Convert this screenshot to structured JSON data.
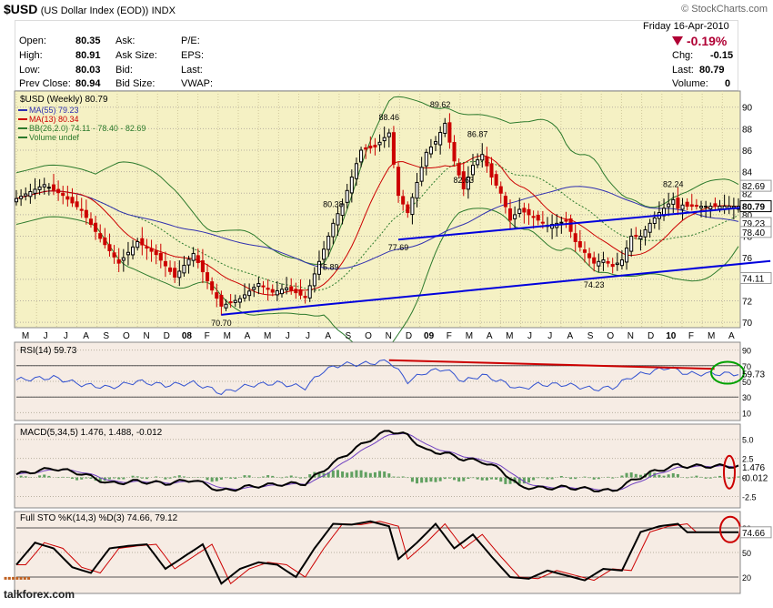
{
  "header": {
    "symbol": "$USD",
    "name": "(US Dollar Index (EOD))",
    "exchange": "INDX",
    "brand": "© StockCharts.com"
  },
  "quote": {
    "date": "Friday  16-Apr-2010",
    "change_pct": "-0.19%",
    "open_label": "Open:",
    "open": "80.35",
    "high_label": "High:",
    "high": "80.91",
    "low_label": "Low:",
    "low": "80.03",
    "prev_label": "Prev Close:",
    "prev": "80.94",
    "ask_label": "Ask:",
    "ask_size_label": "Ask Size:",
    "bid_label": "Bid:",
    "bid_size_label": "Bid Size:",
    "pe_label": "P/E:",
    "eps_label": "EPS:",
    "last_label_mid": "Last:",
    "vwap_label": "VWAP:",
    "chg_label": "Chg:",
    "chg": "-0.15",
    "last_label": "Last:",
    "last": "80.79",
    "volume_label": "Volume:",
    "volume": "0"
  },
  "colors": {
    "price_bg": "#f5f1c4",
    "ind_bg": "#f6ece4",
    "up": "#000000",
    "down": "#cc0000",
    "ma55": "#3030b0",
    "ma13": "#cc0000",
    "bb": "#2c7a2c",
    "trend": "#0000dd",
    "rsi": "#3050d0",
    "macd": "#000000",
    "signal": "#7040c0",
    "hist": "#60a060",
    "sto_k": "#000000",
    "sto_d": "#cc0000",
    "annot": "#00a000"
  },
  "chart_data": [
    {
      "type": "candlestick",
      "title": "$USD (Weekly) 80.79",
      "legend": [
        {
          "label": "MA(55) 79.23",
          "color": "#3030b0"
        },
        {
          "label": "MA(13) 80.34",
          "color": "#cc0000"
        },
        {
          "label": "BB(26,2.0) 74.11 - 78.40 - 82.69",
          "color": "#2c7a2c"
        },
        {
          "label": "Volume undef",
          "color": "#2c7a2c"
        }
      ],
      "x_ticks": [
        "M",
        "J",
        "J",
        "A",
        "S",
        "O",
        "N",
        "D",
        "08",
        "F",
        "M",
        "A",
        "M",
        "J",
        "J",
        "A",
        "S",
        "O",
        "N",
        "D",
        "09",
        "F",
        "M",
        "A",
        "M",
        "J",
        "J",
        "A",
        "S",
        "O",
        "N",
        "D",
        "10",
        "F",
        "M",
        "A"
      ],
      "ylim": [
        69.5,
        91.5
      ],
      "y_ticks": [
        70,
        72,
        74,
        76,
        78,
        80,
        82,
        84,
        86,
        88,
        90
      ],
      "annotations": [
        {
          "label": "70.70",
          "week": 44,
          "value": 70.7
        },
        {
          "label": "75.89",
          "week": 67,
          "value": 75.89
        },
        {
          "label": "80.38",
          "week": 68,
          "value": 80.38
        },
        {
          "label": "88.46",
          "week": 80,
          "value": 88.46
        },
        {
          "label": "77.69",
          "week": 82,
          "value": 77.69
        },
        {
          "label": "89.62",
          "week": 91,
          "value": 89.62
        },
        {
          "label": "82.63",
          "week": 96,
          "value": 82.63
        },
        {
          "label": "86.87",
          "week": 99,
          "value": 86.87
        },
        {
          "label": "74.23",
          "week": 124,
          "value": 74.23
        },
        {
          "label": "82.24",
          "week": 141,
          "value": 82.24
        }
      ],
      "right_labels": [
        {
          "label": "82.69",
          "value": 82.69
        },
        {
          "label": "80.79",
          "value": 80.79
        },
        {
          "label": "79.23",
          "value": 79.23
        },
        {
          "label": "78.40",
          "value": 78.4
        },
        {
          "label": "74.11",
          "value": 74.11
        }
      ],
      "anchors": [
        [
          0,
          81.5
        ],
        [
          6,
          82.8
        ],
        [
          10,
          81.8
        ],
        [
          14,
          80.4
        ],
        [
          18,
          77.8
        ],
        [
          22,
          75.5
        ],
        [
          26,
          77.5
        ],
        [
          30,
          76.3
        ],
        [
          34,
          74.2
        ],
        [
          38,
          76.4
        ],
        [
          42,
          73.0
        ],
        [
          44,
          71.5
        ],
        [
          48,
          72.2
        ],
        [
          52,
          73.6
        ],
        [
          55,
          72.8
        ],
        [
          58,
          73.2
        ],
        [
          62,
          72.3
        ],
        [
          64,
          74.5
        ],
        [
          66,
          76.8
        ],
        [
          68,
          79.2
        ],
        [
          70,
          81.0
        ],
        [
          72,
          83.5
        ],
        [
          74,
          86.0
        ],
        [
          77,
          86.3
        ],
        [
          80,
          87.6
        ],
        [
          82,
          81.8
        ],
        [
          84,
          80.2
        ],
        [
          86,
          83.0
        ],
        [
          88,
          85.8
        ],
        [
          90,
          86.8
        ],
        [
          92,
          88.5
        ],
        [
          94,
          85.0
        ],
        [
          96,
          82.4
        ],
        [
          98,
          84.6
        ],
        [
          100,
          85.6
        ],
        [
          102,
          83.5
        ],
        [
          104,
          82.0
        ],
        [
          106,
          79.5
        ],
        [
          108,
          80.5
        ],
        [
          110,
          80.0
        ],
        [
          114,
          79.0
        ],
        [
          118,
          79.4
        ],
        [
          120,
          77.5
        ],
        [
          122,
          76.5
        ],
        [
          124,
          75.5
        ],
        [
          126,
          75.8
        ],
        [
          128,
          75.2
        ],
        [
          130,
          75.8
        ],
        [
          132,
          78.0
        ],
        [
          134,
          78.0
        ],
        [
          136,
          79.2
        ],
        [
          138,
          80.2
        ],
        [
          140,
          81.0
        ],
        [
          141,
          81.4
        ],
        [
          142,
          80.6
        ],
        [
          143,
          80.9
        ],
        [
          144,
          80.79
        ]
      ],
      "trendlines": [
        {
          "from": [
            44,
            70.7
          ],
          "to": [
            156,
            75.7
          ]
        },
        {
          "from": [
            82,
            77.69
          ],
          "to": [
            156,
            80.9
          ]
        }
      ]
    },
    {
      "type": "line",
      "title": "RSI(14) 59.73",
      "ylim": [
        0,
        100
      ],
      "y_ticks": [
        10,
        30,
        50,
        70,
        90
      ],
      "last_label": "59.73",
      "anchors": [
        [
          0,
          52
        ],
        [
          8,
          55
        ],
        [
          14,
          46
        ],
        [
          20,
          42
        ],
        [
          26,
          50
        ],
        [
          32,
          45
        ],
        [
          38,
          48
        ],
        [
          42,
          40
        ],
        [
          44,
          35
        ],
        [
          50,
          45
        ],
        [
          56,
          48
        ],
        [
          62,
          42
        ],
        [
          66,
          64
        ],
        [
          70,
          72
        ],
        [
          74,
          72
        ],
        [
          80,
          76
        ],
        [
          84,
          50
        ],
        [
          88,
          62
        ],
        [
          92,
          66
        ],
        [
          96,
          50
        ],
        [
          100,
          58
        ],
        [
          104,
          50
        ],
        [
          108,
          40
        ],
        [
          112,
          46
        ],
        [
          118,
          46
        ],
        [
          124,
          40
        ],
        [
          128,
          42
        ],
        [
          132,
          56
        ],
        [
          136,
          62
        ],
        [
          140,
          68
        ],
        [
          144,
          59.73
        ]
      ],
      "resistance": {
        "from": [
          80,
          77
        ],
        "to": [
          144,
          66
        ]
      }
    },
    {
      "type": "line",
      "title": "MACD(5,34,5) 1.476, 1.488, -0.012",
      "ylim": [
        -4,
        7
      ],
      "y_ticks": [
        -2.5,
        0,
        2.5,
        5.0
      ],
      "last_labels": [
        "1.476",
        "-0.012"
      ],
      "anchors": [
        [
          0,
          0.4
        ],
        [
          8,
          1.2
        ],
        [
          14,
          0.5
        ],
        [
          20,
          -0.8
        ],
        [
          26,
          -0.5
        ],
        [
          32,
          -0.8
        ],
        [
          38,
          -0.3
        ],
        [
          44,
          -1.8
        ],
        [
          50,
          -1.2
        ],
        [
          56,
          -0.9
        ],
        [
          62,
          -0.8
        ],
        [
          66,
          1.0
        ],
        [
          72,
          3.5
        ],
        [
          76,
          5.0
        ],
        [
          80,
          6.2
        ],
        [
          84,
          5.5
        ],
        [
          88,
          3.5
        ],
        [
          92,
          3.2
        ],
        [
          96,
          2.4
        ],
        [
          100,
          2.1
        ],
        [
          104,
          1.0
        ],
        [
          108,
          -1.2
        ],
        [
          112,
          -1.4
        ],
        [
          118,
          -1.3
        ],
        [
          124,
          -1.6
        ],
        [
          128,
          -1.8
        ],
        [
          132,
          -0.5
        ],
        [
          136,
          0.6
        ],
        [
          140,
          1.3
        ],
        [
          142,
          1.6
        ],
        [
          144,
          1.476
        ]
      ]
    },
    {
      "type": "line",
      "title": "Full STO %K(14,3) %D(3) 74.66, 79.12",
      "ylim": [
        0,
        100
      ],
      "y_ticks": [
        20,
        50,
        80
      ],
      "last_label": "74.66",
      "anchors": [
        [
          0,
          35
        ],
        [
          4,
          62
        ],
        [
          8,
          55
        ],
        [
          12,
          32
        ],
        [
          16,
          25
        ],
        [
          20,
          55
        ],
        [
          24,
          58
        ],
        [
          28,
          60
        ],
        [
          32,
          30
        ],
        [
          36,
          45
        ],
        [
          40,
          60
        ],
        [
          44,
          12
        ],
        [
          48,
          30
        ],
        [
          52,
          38
        ],
        [
          56,
          35
        ],
        [
          60,
          20
        ],
        [
          64,
          55
        ],
        [
          68,
          85
        ],
        [
          72,
          84
        ],
        [
          76,
          88
        ],
        [
          80,
          82
        ],
        [
          82,
          42
        ],
        [
          86,
          62
        ],
        [
          90,
          85
        ],
        [
          94,
          55
        ],
        [
          98,
          72
        ],
        [
          102,
          45
        ],
        [
          106,
          20
        ],
        [
          110,
          18
        ],
        [
          114,
          28
        ],
        [
          118,
          22
        ],
        [
          122,
          16
        ],
        [
          126,
          30
        ],
        [
          130,
          28
        ],
        [
          134,
          75
        ],
        [
          138,
          82
        ],
        [
          142,
          85
        ],
        [
          144,
          74.66
        ]
      ]
    }
  ]
}
